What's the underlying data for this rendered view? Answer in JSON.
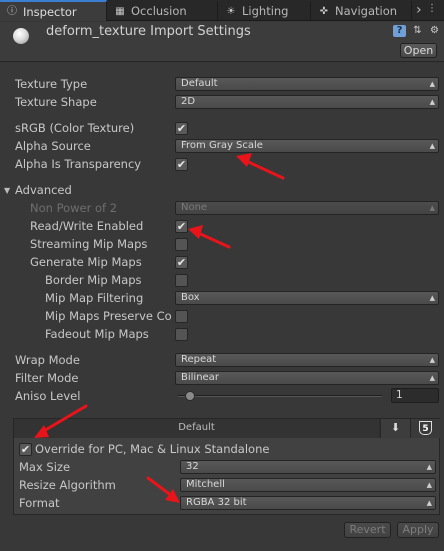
{
  "tabs": [
    {
      "label": "Inspector",
      "icon": "info-icon",
      "active": true
    },
    {
      "label": "Occlusion",
      "icon": "occlusion-icon",
      "active": false
    },
    {
      "label": "Lighting",
      "icon": "lighting-icon",
      "active": false
    },
    {
      "label": "Navigation",
      "icon": "navigation-icon",
      "active": false
    }
  ],
  "header": {
    "title": "deform_texture Import Settings",
    "open_label": "Open"
  },
  "fields": {
    "texture_type": {
      "label": "Texture Type",
      "value": "Default"
    },
    "texture_shape": {
      "label": "Texture Shape",
      "value": "2D"
    },
    "srgb": {
      "label": "sRGB (Color Texture)",
      "checked": true
    },
    "alpha_source": {
      "label": "Alpha Source",
      "value": "From Gray Scale"
    },
    "alpha_transparency": {
      "label": "Alpha Is Transparency",
      "checked": true
    },
    "advanced": {
      "label": "Advanced",
      "expanded": true
    },
    "non_power_of_2": {
      "label": "Non Power of 2",
      "value": "None"
    },
    "read_write": {
      "label": "Read/Write Enabled",
      "checked": true
    },
    "streaming_mips": {
      "label": "Streaming Mip Maps",
      "checked": false
    },
    "generate_mips": {
      "label": "Generate Mip Maps",
      "checked": true
    },
    "border_mips": {
      "label": "Border Mip Maps",
      "checked": false
    },
    "mip_filtering": {
      "label": "Mip Map Filtering",
      "value": "Box"
    },
    "mips_preserve": {
      "label": "Mip Maps Preserve Co",
      "checked": false
    },
    "fadeout_mips": {
      "label": "Fadeout Mip Maps",
      "checked": false
    },
    "wrap_mode": {
      "label": "Wrap Mode",
      "value": "Repeat"
    },
    "filter_mode": {
      "label": "Filter Mode",
      "value": "Bilinear"
    },
    "aniso_level": {
      "label": "Aniso Level",
      "value": "1"
    }
  },
  "platform": {
    "default_tab": "Default",
    "override": {
      "label": "Override for PC, Mac & Linux Standalone",
      "checked": true
    },
    "max_size": {
      "label": "Max Size",
      "value": "32"
    },
    "resize_algorithm": {
      "label": "Resize Algorithm",
      "value": "Mitchell"
    },
    "format": {
      "label": "Format",
      "value": "RGBA 32 bit"
    }
  },
  "buttons": {
    "revert": "Revert",
    "apply": "Apply"
  },
  "glyphs": {
    "check": "✔",
    "dd_arrow": "▲▼",
    "fold_open": "▼",
    "more": "›",
    "help": "?",
    "download": "⬇",
    "html5": "5"
  },
  "colors": {
    "annotation_arrow": "#e8141a",
    "active_tab_accent": "#3a7fd1"
  }
}
